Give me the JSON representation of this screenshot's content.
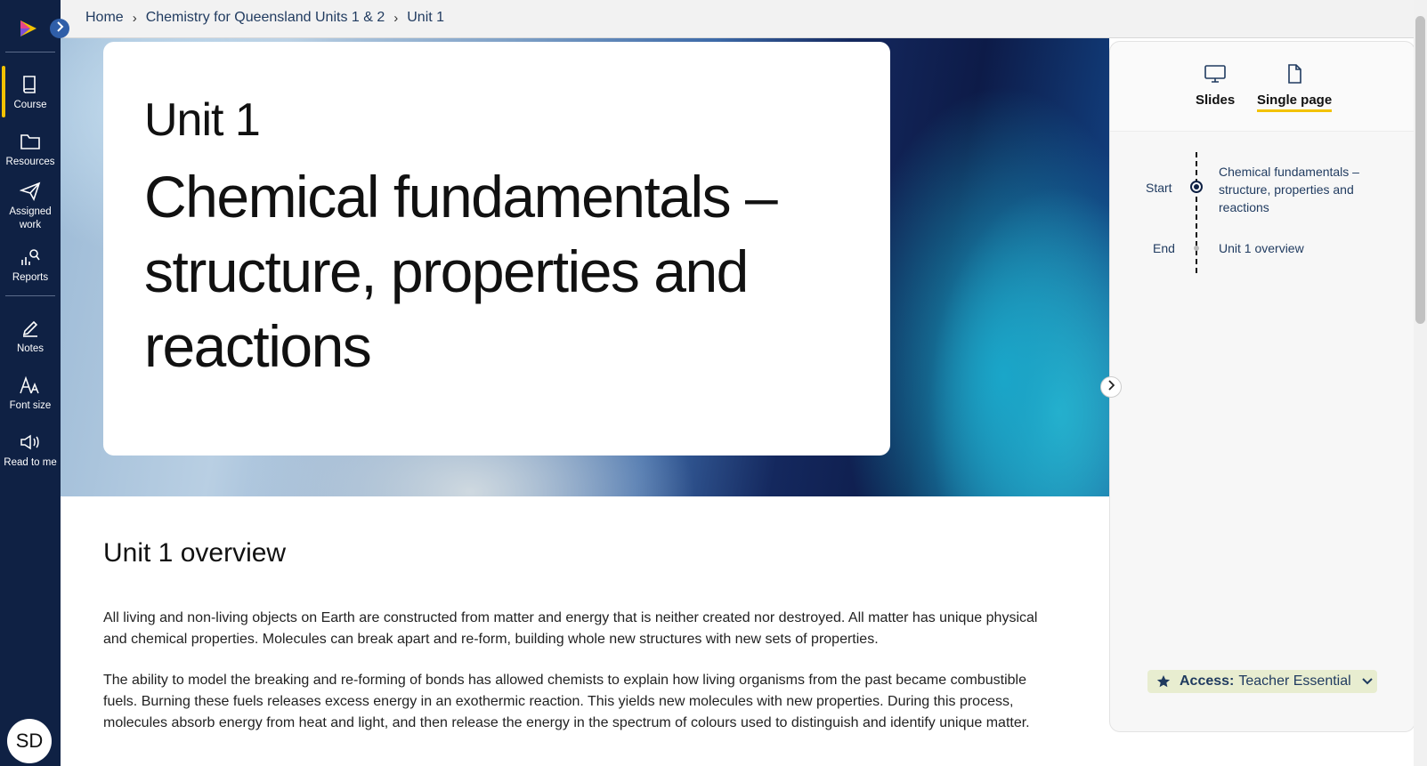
{
  "sidebar": {
    "items": [
      {
        "label": "Course",
        "icon": "book-icon"
      },
      {
        "label": "Resources",
        "icon": "folder-icon"
      },
      {
        "label": "Assigned work",
        "icon": "paper-plane-icon"
      },
      {
        "label": "Reports",
        "icon": "chart-search-icon"
      },
      {
        "label": "Notes",
        "icon": "pencil-icon"
      },
      {
        "label": "Font size",
        "icon": "font-size-icon"
      },
      {
        "label": "Read to me",
        "icon": "speaker-icon"
      }
    ],
    "avatar_initials": "SD"
  },
  "breadcrumb": [
    "Home",
    "Chemistry for Queensland Units 1 & 2",
    "Unit 1"
  ],
  "hero": {
    "unit_label": "Unit 1",
    "title": "Chemical fundamentals – structure, properties and reactions"
  },
  "content": {
    "heading": "Unit 1 overview",
    "paragraphs": [
      "All living and non-living objects on Earth are constructed from matter and energy that is neither created nor destroyed. All matter has unique physical and chemical properties. Molecules can break apart and re-form, building whole new structures with new sets of properties.",
      "The ability to model the breaking and re-forming of bonds has allowed chemists to explain how living organisms from the past became combustible fuels. Burning these fuels releases excess energy in an exothermic reaction. This yields new molecules with new properties. During this process, molecules absorb energy from heat and light, and then release the energy in the spectrum of colours used to distinguish and identify unique matter."
    ]
  },
  "right_panel": {
    "view_tabs": [
      {
        "label": "Slides",
        "icon": "monitor-icon",
        "active": false
      },
      {
        "label": "Single page",
        "icon": "document-icon",
        "active": true
      }
    ],
    "timeline": [
      {
        "marker": "Start",
        "label": "Chemical fundamentals – structure, properties and reactions"
      },
      {
        "marker": "End",
        "label": "Unit 1 overview"
      }
    ],
    "access": {
      "prefix": "Access:",
      "value": "Teacher Essential"
    }
  },
  "colors": {
    "sidebar_bg": "#0f2144",
    "accent_yellow": "#f2c200",
    "link_blue": "#1f3a5f",
    "access_chip_bg": "#e8edd0"
  }
}
